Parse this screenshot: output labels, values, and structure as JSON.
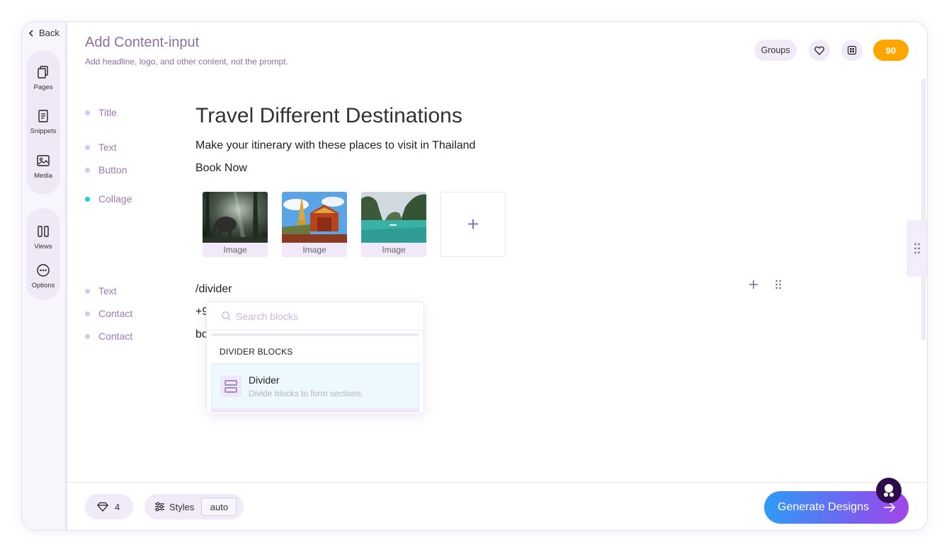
{
  "nav": {
    "back_label": "Back"
  },
  "rail": {
    "items": [
      {
        "label": "Pages",
        "icon": "pages-icon"
      },
      {
        "label": "Snippets",
        "icon": "snippets-icon"
      },
      {
        "label": "Media",
        "icon": "media-icon"
      },
      {
        "label": "Views",
        "icon": "views-icon"
      },
      {
        "label": "Options",
        "icon": "options-icon"
      }
    ]
  },
  "header": {
    "title": "Add Content-input",
    "subtitle": "Add headline, logo, and other content, not the prompt.",
    "groups_label": "Groups",
    "score": "90"
  },
  "rows": [
    {
      "label": "Title",
      "value": "Travel Different Destinations"
    },
    {
      "label": "Text",
      "value": "Make your itinerary with these places to visit in Thailand"
    },
    {
      "label": "Button",
      "value": "Book Now"
    },
    {
      "label": "Collage"
    },
    {
      "label": "Text",
      "value": "/divider"
    },
    {
      "label": "Contact",
      "value": "+9"
    },
    {
      "label": "Contact",
      "value": "bo"
    }
  ],
  "collage": {
    "images": [
      {
        "caption": "Image",
        "scene": "elephant-forest"
      },
      {
        "caption": "Image",
        "scene": "thai-temple"
      },
      {
        "caption": "Image",
        "scene": "tropical-bay"
      }
    ],
    "add_label": "+"
  },
  "dropdown": {
    "search_placeholder": "Search blocks",
    "section_header": "DIVIDER BLOCKS",
    "option": {
      "title": "Divider",
      "description": "Divide blocks to form sections."
    }
  },
  "footer": {
    "count": "4",
    "styles_label": "Styles",
    "styles_value": "auto",
    "generate_label": "Generate Designs"
  },
  "colors": {
    "accent": "#8a6fa8",
    "score_bg": "#ffa500",
    "gradient_start": "#2f9bf6",
    "gradient_end": "#a347e8"
  }
}
